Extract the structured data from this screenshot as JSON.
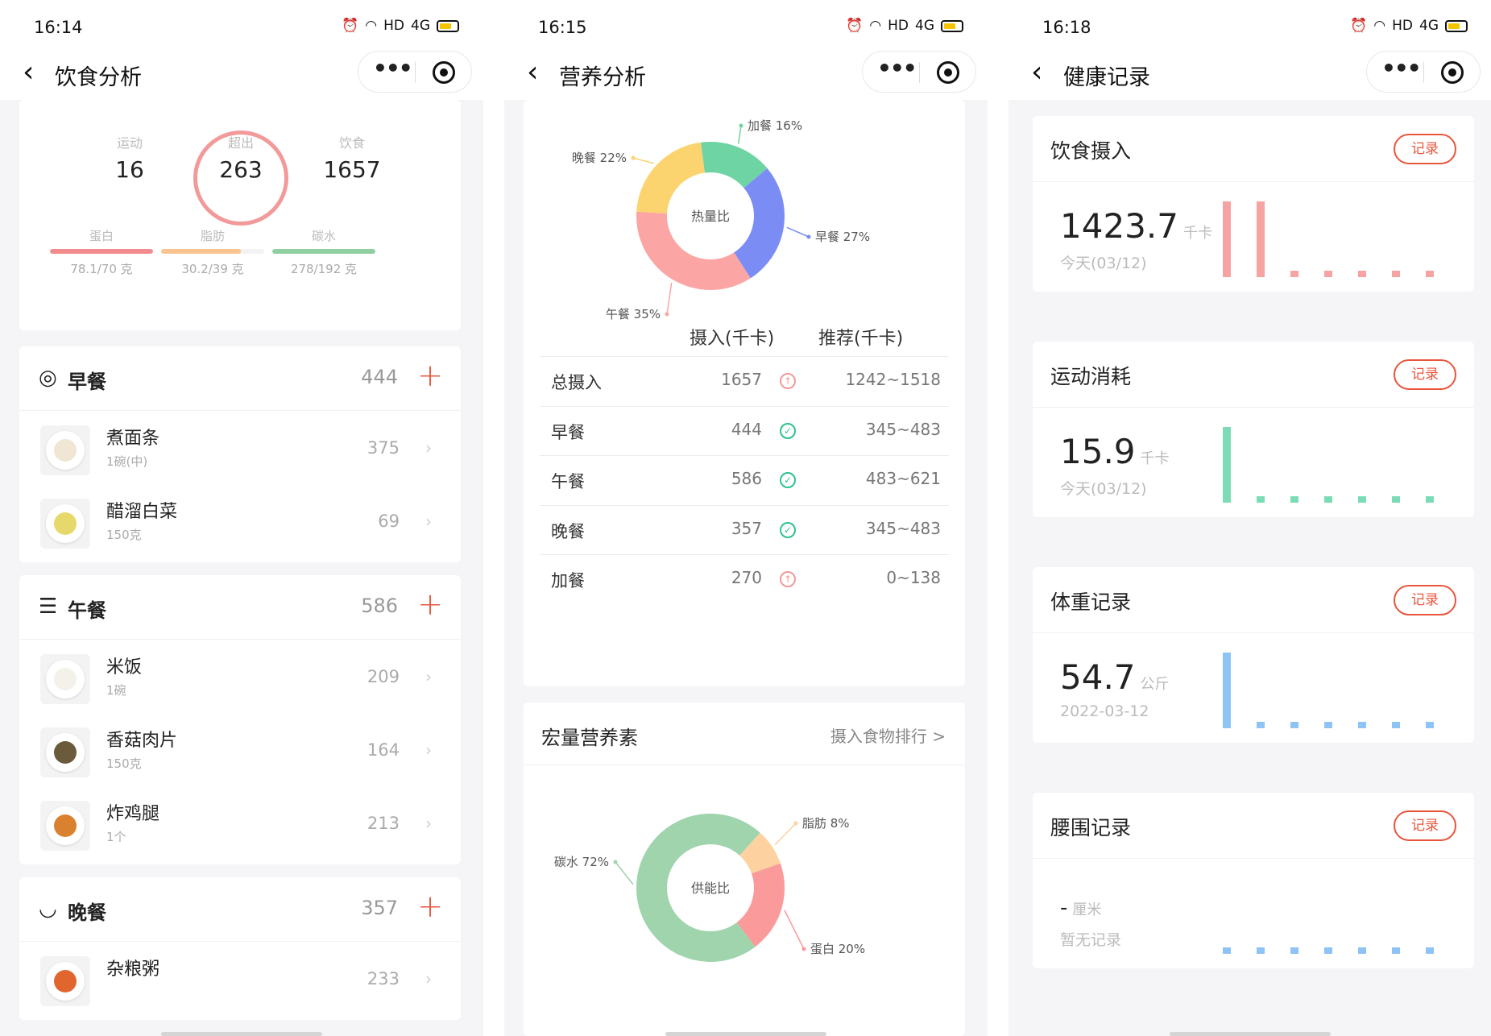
{
  "status": {
    "times": [
      "16:14",
      "16:15",
      "16:18"
    ],
    "hd": "HD",
    "signal": "4G"
  },
  "screens": {
    "diet": {
      "title": "饮食分析",
      "summary": {
        "exercise_label": "运动",
        "exercise_value": "16",
        "over_label": "超出",
        "over_value": "263",
        "food_label": "饮食",
        "food_value": "1657"
      },
      "macros": [
        {
          "label": "蛋白",
          "value": "78.1/70 克",
          "color": "#f28c8c",
          "fill": 1.0
        },
        {
          "label": "脂肪",
          "value": "30.2/39 克",
          "color": "#f9c48f",
          "fill": 0.77
        },
        {
          "label": "碳水",
          "value": "278/192 克",
          "color": "#8fcfa0",
          "fill": 1.0
        }
      ],
      "meals": [
        {
          "title": "早餐",
          "kcal": "444",
          "icon": "target-icon",
          "foods": [
            {
              "name": "煮面条",
              "amount": "1碗(中)",
              "kcal": "375",
              "dish_color": "#efe6d4"
            },
            {
              "name": "醋溜白菜",
              "amount": "150克",
              "kcal": "69",
              "dish_color": "#e6d86a"
            }
          ]
        },
        {
          "title": "午餐",
          "kcal": "586",
          "icon": "burger-icon",
          "foods": [
            {
              "name": "米饭",
              "amount": "1碗",
              "kcal": "209",
              "dish_color": "#f4f1ea"
            },
            {
              "name": "香菇肉片",
              "amount": "150克",
              "kcal": "164",
              "dish_color": "#6b5a3c"
            },
            {
              "name": "炸鸡腿",
              "amount": "1个",
              "kcal": "213",
              "dish_color": "#d9812e"
            }
          ]
        },
        {
          "title": "晚餐",
          "kcal": "357",
          "icon": "bowl-icon",
          "foods": [
            {
              "name": "杂粮粥",
              "amount": "",
              "kcal": "233",
              "dish_color": "#e0662e"
            }
          ]
        }
      ]
    },
    "nutrition": {
      "title": "营养分析",
      "donut1": {
        "center": "热量比",
        "slices": [
          {
            "label": "早餐 27%",
            "value": 27,
            "color": "#7b8cf5"
          },
          {
            "label": "午餐 35%",
            "value": 35,
            "color": "#fca5a5"
          },
          {
            "label": "晚餐 22%",
            "value": 22,
            "color": "#fcd46f"
          },
          {
            "label": "加餐 16%",
            "value": 16,
            "color": "#6fd4a3"
          }
        ]
      },
      "table": {
        "col_in": "摄入(千卡)",
        "col_rec": "推荐(千卡)",
        "rows": [
          {
            "name": "总摄入",
            "intake": "1657",
            "status": "over",
            "rec": "1242~1518"
          },
          {
            "name": "早餐",
            "intake": "444",
            "status": "ok",
            "rec": "345~483"
          },
          {
            "name": "午餐",
            "intake": "586",
            "status": "ok",
            "rec": "483~621"
          },
          {
            "name": "晚餐",
            "intake": "357",
            "status": "ok",
            "rec": "345~483"
          },
          {
            "name": "加餐",
            "intake": "270",
            "status": "over",
            "rec": "0~138"
          }
        ]
      },
      "macro_title": "宏量营养素",
      "macro_link": "摄入食物排行 >",
      "donut2": {
        "center": "供能比",
        "slices": [
          {
            "label": "脂肪 8%",
            "value": 8,
            "color": "#fdd2a0"
          },
          {
            "label": "蛋白 20%",
            "value": 20,
            "color": "#fa9a9a"
          },
          {
            "label": "碳水 72%",
            "value": 72,
            "color": "#9fd4ad"
          }
        ]
      }
    },
    "health": {
      "title": "健康记录",
      "record_label": "记录",
      "cards": [
        {
          "title": "饮食摄入",
          "value": "1423.7",
          "unit": "千卡",
          "date": "今天(03/12)",
          "color": "#f5a3a3",
          "bars": [
            1,
            1,
            0,
            0,
            0,
            0,
            0
          ]
        },
        {
          "title": "运动消耗",
          "value": "15.9",
          "unit": "千卡",
          "date": "今天(03/12)",
          "color": "#7ddcb8",
          "bars": [
            1,
            0,
            0,
            0,
            0,
            0,
            0
          ]
        },
        {
          "title": "体重记录",
          "value": "54.7",
          "unit": "公斤",
          "date": "2022-03-12",
          "color": "#8ec3f5",
          "bars": [
            1,
            0,
            0,
            0,
            0,
            0,
            0
          ]
        },
        {
          "title": "腰围记录",
          "value": "-",
          "unit": "厘米",
          "date": "暂无记录",
          "color": "#8ec3f5",
          "bars": [
            0,
            0,
            0,
            0,
            0,
            0,
            0
          ]
        }
      ]
    }
  }
}
